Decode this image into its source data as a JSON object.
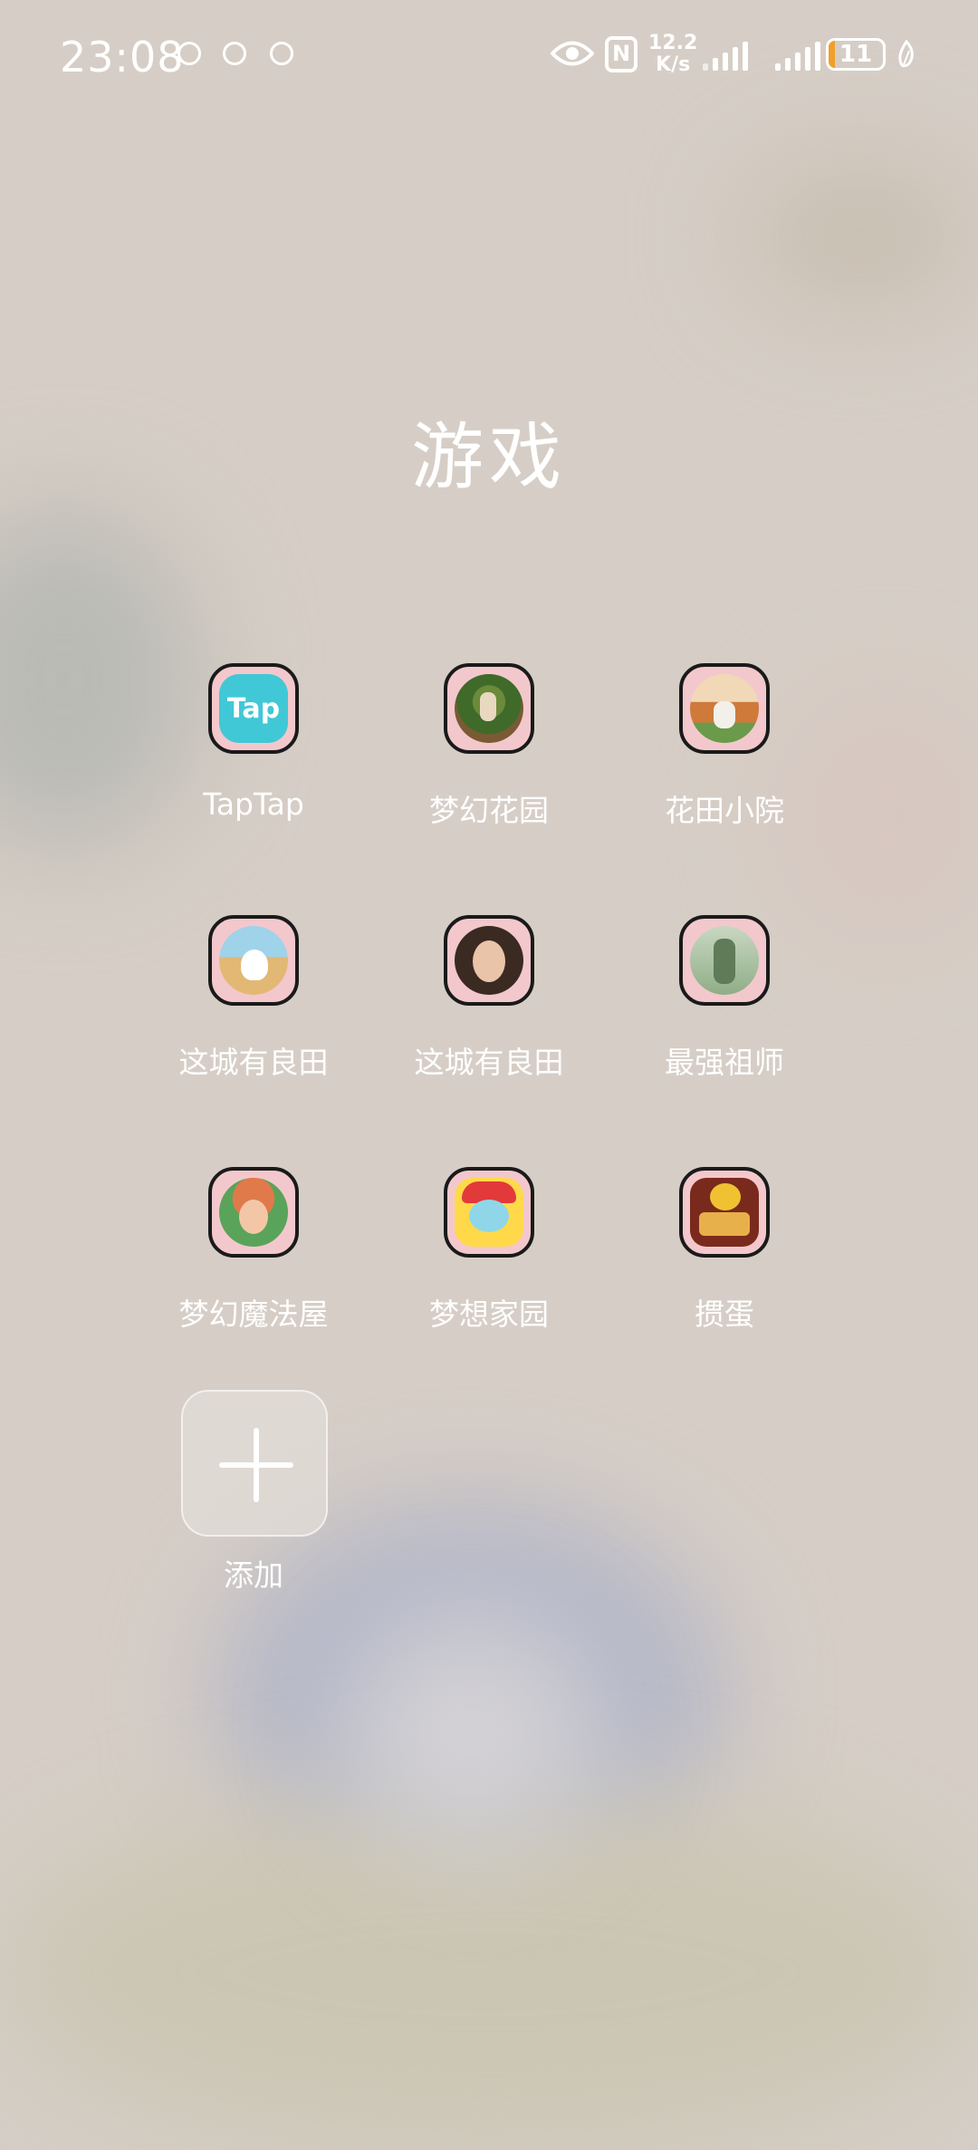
{
  "status_bar": {
    "time": "23:08",
    "net_speed_value": "12.2",
    "net_speed_unit": "K/s",
    "battery_level": "11",
    "battery_percent": 11
  },
  "folder": {
    "title": "游戏",
    "apps": [
      {
        "label": "TapTap",
        "icon": "taptap-icon"
      },
      {
        "label": "梦幻花园",
        "icon": "garden-game-icon"
      },
      {
        "label": "花田小院",
        "icon": "flower-field-icon"
      },
      {
        "label": "这城有良田",
        "icon": "goose-farm-icon"
      },
      {
        "label": "这城有良田",
        "icon": "girl-portrait-icon"
      },
      {
        "label": "最强祖师",
        "icon": "master-game-icon"
      },
      {
        "label": "梦幻魔法屋",
        "icon": "magic-house-icon"
      },
      {
        "label": "梦想家园",
        "icon": "dream-home-icon"
      },
      {
        "label": "掼蛋",
        "icon": "guandan-icon"
      }
    ],
    "add_label": "添加"
  },
  "colors": {
    "icon_border": "#1a1a1a",
    "icon_bg": "#f3c8cc",
    "taptap": "#41c8d6",
    "battery_fill": "#f0a02a"
  },
  "icons": {
    "taptap_text": "Tap",
    "nfc": "N"
  }
}
